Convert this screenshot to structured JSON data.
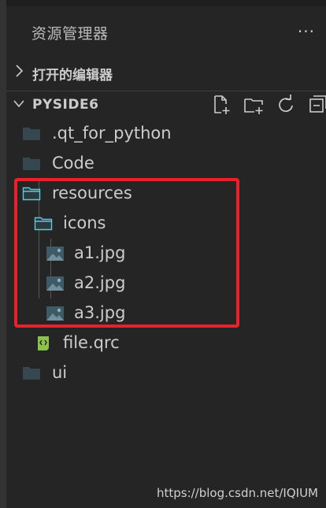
{
  "explorer": {
    "title": "资源管理器",
    "more_label": "···"
  },
  "sections": {
    "open_editors": "打开的编辑器",
    "workspace": "PYSIDE6"
  },
  "toolbar": {
    "new_file": "new-file-icon",
    "new_folder": "new-folder-icon",
    "refresh": "refresh-icon",
    "collapse": "collapse-all-icon"
  },
  "tree": {
    "items": [
      {
        "label": ".qt_for_python",
        "type": "folder",
        "state": "closed"
      },
      {
        "label": "Code",
        "type": "folder",
        "state": "closed"
      },
      {
        "label": "resources",
        "type": "folder",
        "state": "open"
      },
      {
        "label": "icons",
        "type": "folder",
        "state": "open"
      },
      {
        "label": "a1.jpg",
        "type": "image"
      },
      {
        "label": "a2.jpg",
        "type": "image"
      },
      {
        "label": "a3.jpg",
        "type": "image"
      },
      {
        "label": "file.qrc",
        "type": "qrc"
      },
      {
        "label": "ui",
        "type": "folder",
        "state": "closed"
      }
    ]
  },
  "colors": {
    "background": "#252526",
    "highlight": "#e8212b",
    "folder": "#37474f",
    "open_folder_outline": "#5fc8d8",
    "qrc_icon": "#8bc34a"
  },
  "watermark": "https://blog.csdn.net/IQIUM"
}
